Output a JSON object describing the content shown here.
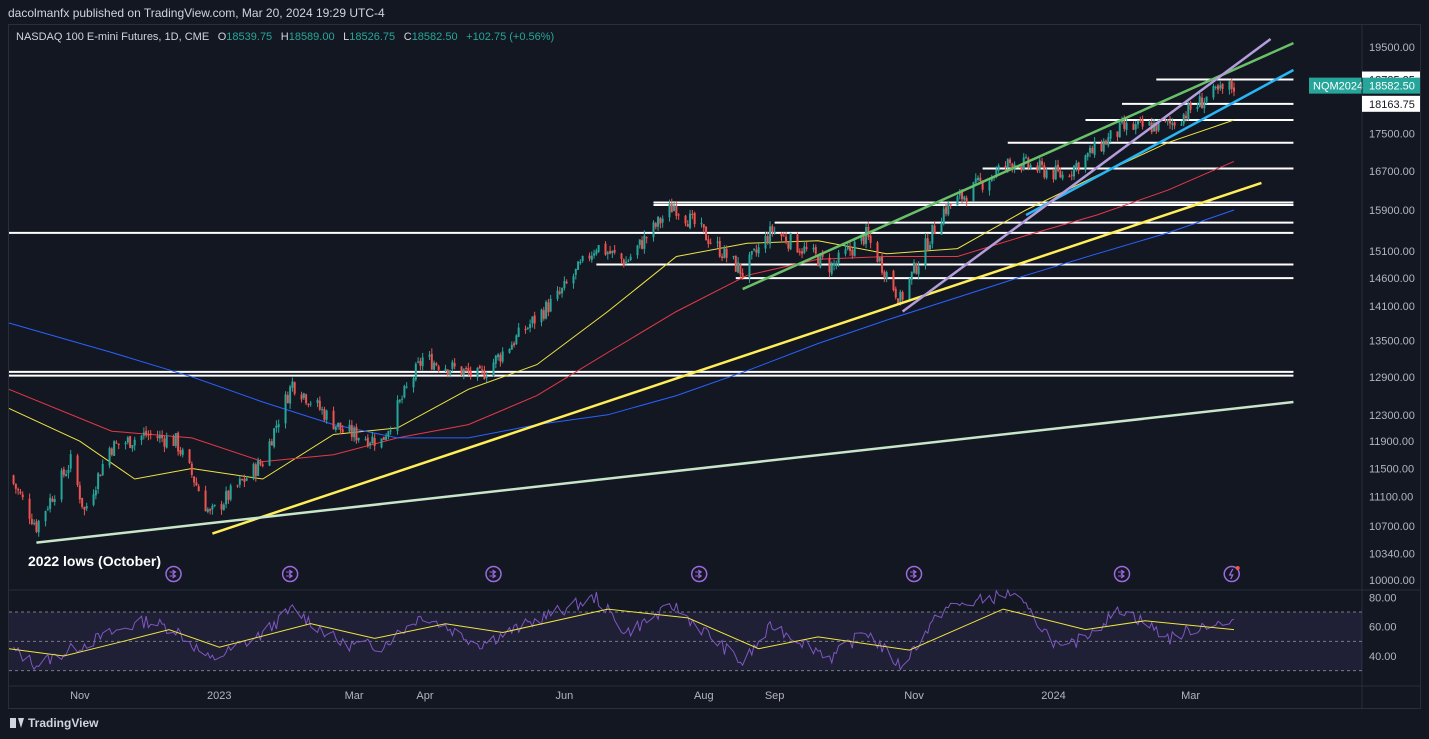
{
  "header": {
    "publisher": "dacolmanfx published on TradingView.com, Mar 20, 2024 19:29 UTC-4",
    "symbol_title": "NASDAQ 100 E-mini Futures, 1D, CME",
    "ohlc": {
      "O": "18539.75",
      "H": "18589.00",
      "L": "18526.75",
      "C": "18582.50",
      "change": "+102.75 (+0.56%)"
    }
  },
  "footer": {
    "brand": "TradingView"
  },
  "colors": {
    "background": "#131722",
    "grid": "#1e222d",
    "up": "#26a69a",
    "down": "#ef5350",
    "ma20": "#f0e442",
    "ma50": "#e63946",
    "ma200": "#2962ff",
    "rsi": "#7e57c2",
    "rsi_ma": "#f0e442",
    "trend_yellow": "#ffee58",
    "trend_green": "#6abf69",
    "trend_cyan": "#29b6f6",
    "trend_lavender": "#b39ddb",
    "trend_mint": "#c8e6c9",
    "horizontal": "#ffffff",
    "price_badge": "#26a69a"
  },
  "chart_data": [
    {
      "type": "candlestick",
      "title": "NASDAQ 100 E-mini Futures, 1D, CME",
      "price_axis_ticks": [
        19500,
        18725.25,
        18582.5,
        18163.75,
        17500,
        16700,
        15900,
        15100,
        14600,
        14100,
        13500,
        12900,
        12300,
        11900,
        11500,
        11100,
        10700,
        10340,
        10000
      ],
      "price_axis_labels": [
        "19500.00",
        "18725.25",
        "18582.50",
        "18163.75",
        "17500.00",
        "16700.00",
        "15900.00",
        "15100.00",
        "14600.00",
        "14100.00",
        "13500.00",
        "12900.00",
        "12300.00",
        "11900.00",
        "11500.00",
        "11100.00",
        "10700.00",
        "10340.00",
        "10000.00"
      ],
      "time_axis_labels": [
        "Nov",
        "2023",
        "Mar",
        "Apr",
        "Jun",
        "Aug",
        "Sep",
        "Nov",
        "2024",
        "Mar"
      ],
      "time_axis_dates": [
        "2022-11-01",
        "2023-01-01",
        "2023-03-01",
        "2023-04-01",
        "2023-06-01",
        "2023-08-01",
        "2023-09-01",
        "2023-11-01",
        "2024-01-01",
        "2024-03-01"
      ],
      "ylim": [
        10000,
        19800
      ],
      "xlim": [
        "2022-10-01",
        "2024-05-15"
      ],
      "close_path": [
        {
          "date": "2022-10-01",
          "close": 11400
        },
        {
          "date": "2022-10-13",
          "close": 10700
        },
        {
          "date": "2022-10-28",
          "close": 11600
        },
        {
          "date": "2022-11-03",
          "close": 10900
        },
        {
          "date": "2022-11-14",
          "close": 11800
        },
        {
          "date": "2022-11-30",
          "close": 12000
        },
        {
          "date": "2022-12-13",
          "close": 11900
        },
        {
          "date": "2022-12-28",
          "close": 10850
        },
        {
          "date": "2023-01-20",
          "close": 11600
        },
        {
          "date": "2023-02-02",
          "close": 12800
        },
        {
          "date": "2023-02-24",
          "close": 12050
        },
        {
          "date": "2023-03-13",
          "close": 11900
        },
        {
          "date": "2023-03-31",
          "close": 13200
        },
        {
          "date": "2023-04-25",
          "close": 12900
        },
        {
          "date": "2023-05-30",
          "close": 14300
        },
        {
          "date": "2023-06-15",
          "close": 15200
        },
        {
          "date": "2023-06-28",
          "close": 14900
        },
        {
          "date": "2023-07-19",
          "close": 16000
        },
        {
          "date": "2023-08-18",
          "close": 14700
        },
        {
          "date": "2023-08-31",
          "close": 15500
        },
        {
          "date": "2023-09-26",
          "close": 14800
        },
        {
          "date": "2023-10-11",
          "close": 15400
        },
        {
          "date": "2023-10-26",
          "close": 14200
        },
        {
          "date": "2023-11-14",
          "close": 15900
        },
        {
          "date": "2023-12-14",
          "close": 16900
        },
        {
          "date": "2024-01-05",
          "close": 16600
        },
        {
          "date": "2024-01-31",
          "close": 17600
        },
        {
          "date": "2024-02-21",
          "close": 17700
        },
        {
          "date": "2024-03-08",
          "close": 18300
        },
        {
          "date": "2024-03-20",
          "close": 18582.5
        }
      ],
      "moving_averages": [
        {
          "color": "#f0e442",
          "points": [
            {
              "date": "2022-10-01",
              "close": 12400
            },
            {
              "date": "2022-11-01",
              "close": 11900
            },
            {
              "date": "2022-11-25",
              "close": 11350
            },
            {
              "date": "2022-12-20",
              "close": 11500
            },
            {
              "date": "2023-01-20",
              "close": 11350
            },
            {
              "date": "2023-02-20",
              "close": 12000
            },
            {
              "date": "2023-03-20",
              "close": 12100
            },
            {
              "date": "2023-04-20",
              "close": 12700
            },
            {
              "date": "2023-05-20",
              "close": 13100
            },
            {
              "date": "2023-06-20",
              "close": 14000
            },
            {
              "date": "2023-07-20",
              "close": 15000
            },
            {
              "date": "2023-08-20",
              "close": 15250
            },
            {
              "date": "2023-09-20",
              "close": 15300
            },
            {
              "date": "2023-10-20",
              "close": 15050
            },
            {
              "date": "2023-11-20",
              "close": 15150
            },
            {
              "date": "2023-12-20",
              "close": 15900
            },
            {
              "date": "2024-01-20",
              "close": 16600
            },
            {
              "date": "2024-02-20",
              "close": 17300
            },
            {
              "date": "2024-03-20",
              "close": 17800
            }
          ]
        },
        {
          "color": "#e63946",
          "points": [
            {
              "date": "2022-10-01",
              "close": 12700
            },
            {
              "date": "2022-11-15",
              "close": 12050
            },
            {
              "date": "2022-12-20",
              "close": 11950
            },
            {
              "date": "2023-01-20",
              "close": 11600
            },
            {
              "date": "2023-02-20",
              "close": 11700
            },
            {
              "date": "2023-03-20",
              "close": 11950
            },
            {
              "date": "2023-04-20",
              "close": 12150
            },
            {
              "date": "2023-05-20",
              "close": 12600
            },
            {
              "date": "2023-06-20",
              "close": 13300
            },
            {
              "date": "2023-07-20",
              "close": 14000
            },
            {
              "date": "2023-08-20",
              "close": 14650
            },
            {
              "date": "2023-09-20",
              "close": 14950
            },
            {
              "date": "2023-10-20",
              "close": 15000
            },
            {
              "date": "2023-11-20",
              "close": 15000
            },
            {
              "date": "2023-12-20",
              "close": 15400
            },
            {
              "date": "2024-01-20",
              "close": 15800
            },
            {
              "date": "2024-02-20",
              "close": 16300
            },
            {
              "date": "2024-03-20",
              "close": 16900
            }
          ]
        },
        {
          "color": "#2962ff",
          "points": [
            {
              "date": "2022-10-01",
              "close": 13800
            },
            {
              "date": "2022-11-15",
              "close": 13300
            },
            {
              "date": "2022-12-20",
              "close": 12900
            },
            {
              "date": "2023-01-20",
              "close": 12500
            },
            {
              "date": "2023-02-20",
              "close": 12150
            },
            {
              "date": "2023-03-20",
              "close": 11950
            },
            {
              "date": "2023-04-20",
              "close": 11950
            },
            {
              "date": "2023-05-20",
              "close": 12150
            },
            {
              "date": "2023-06-20",
              "close": 12300
            },
            {
              "date": "2023-07-20",
              "close": 12600
            },
            {
              "date": "2023-08-20",
              "close": 13000
            },
            {
              "date": "2023-09-20",
              "close": 13450
            },
            {
              "date": "2023-10-20",
              "close": 13850
            },
            {
              "date": "2023-11-20",
              "close": 14250
            },
            {
              "date": "2023-12-20",
              "close": 14650
            },
            {
              "date": "2024-01-20",
              "close": 15050
            },
            {
              "date": "2024-02-20",
              "close": 15450
            },
            {
              "date": "2024-03-20",
              "close": 15900
            }
          ]
        }
      ],
      "horizontal_levels": [
        {
          "price": 18725.25,
          "from": "2024-02-15",
          "to": "2024-04-15"
        },
        {
          "price": 18163.75,
          "from": "2024-01-31",
          "to": "2024-04-15"
        },
        {
          "price": 17800,
          "from": "2024-01-15",
          "to": "2024-04-15"
        },
        {
          "price": 17300,
          "from": "2023-12-12",
          "to": "2024-04-15"
        },
        {
          "price": 16750,
          "from": "2023-12-01",
          "to": "2024-04-15"
        },
        {
          "price": 16050,
          "from": "2023-07-10",
          "to": "2024-04-15"
        },
        {
          "price": 16000,
          "from": "2023-07-10",
          "to": "2024-04-15"
        },
        {
          "price": 15650,
          "from": "2023-09-01",
          "to": "2024-04-15"
        },
        {
          "price": 15450,
          "from": "2022-10-01",
          "to": "2024-04-15"
        },
        {
          "price": 14850,
          "from": "2023-06-15",
          "to": "2024-04-15"
        },
        {
          "price": 14600,
          "from": "2023-08-15",
          "to": "2024-04-15"
        },
        {
          "price": 12980,
          "from": "2022-10-01",
          "to": "2024-04-15"
        },
        {
          "price": 12920,
          "from": "2022-10-01",
          "to": "2024-04-15"
        }
      ],
      "trendlines": [
        {
          "color": "#ffee58",
          "from": {
            "date": "2022-12-29",
            "price": 10600
          },
          "to": {
            "date": "2024-04-01",
            "price": 16450
          }
        },
        {
          "color": "#c8e6c9",
          "from": {
            "date": "2022-10-13",
            "price": 10480
          },
          "to": {
            "date": "2024-04-15",
            "price": 12500
          }
        },
        {
          "color": "#6abf69",
          "from": {
            "date": "2023-08-18",
            "price": 14400
          },
          "to": {
            "date": "2024-04-15",
            "price": 19600
          }
        },
        {
          "color": "#29b6f6",
          "from": {
            "date": "2023-12-20",
            "price": 15800
          },
          "to": {
            "date": "2024-04-15",
            "price": 18950
          }
        },
        {
          "color": "#b39ddb",
          "from": {
            "date": "2023-10-27",
            "price": 14000
          },
          "to": {
            "date": "2024-04-05",
            "price": 19700
          }
        }
      ],
      "annotations": [
        {
          "text": "2022 lows (October)",
          "date": "2022-10-13",
          "price": 10400
        }
      ],
      "event_marker_dates": [
        "2022-12-12",
        "2023-02-01",
        "2023-05-01",
        "2023-07-30",
        "2023-11-01",
        "2024-01-31",
        "2024-03-19"
      ],
      "last_price_tag": {
        "symbol": "NQM2024",
        "value": "18582.50"
      }
    },
    {
      "type": "line",
      "title": "RSI",
      "ylim": [
        25,
        85
      ],
      "axis_labels": [
        "80.00",
        "60.00",
        "40.00"
      ],
      "axis_values": [
        80,
        60,
        40
      ],
      "band": [
        30,
        70
      ],
      "series": [
        {
          "points": [
            {
              "date": "2022-10-01",
              "value": 46
            },
            {
              "date": "2022-10-13",
              "value": 34
            },
            {
              "date": "2022-11-01",
              "value": 47
            },
            {
              "date": "2022-11-14",
              "value": 55
            },
            {
              "date": "2022-11-30",
              "value": 64
            },
            {
              "date": "2022-12-13",
              "value": 58
            },
            {
              "date": "2022-12-28",
              "value": 37
            },
            {
              "date": "2023-01-20",
              "value": 55
            },
            {
              "date": "2023-02-02",
              "value": 72
            },
            {
              "date": "2023-02-24",
              "value": 48
            },
            {
              "date": "2023-03-13",
              "value": 47
            },
            {
              "date": "2023-03-31",
              "value": 68
            },
            {
              "date": "2023-04-25",
              "value": 48
            },
            {
              "date": "2023-05-30",
              "value": 71
            },
            {
              "date": "2023-06-15",
              "value": 80
            },
            {
              "date": "2023-06-28",
              "value": 56
            },
            {
              "date": "2023-07-19",
              "value": 74
            },
            {
              "date": "2023-08-18",
              "value": 35
            },
            {
              "date": "2023-08-31",
              "value": 61
            },
            {
              "date": "2023-09-26",
              "value": 39
            },
            {
              "date": "2023-10-11",
              "value": 57
            },
            {
              "date": "2023-10-26",
              "value": 33
            },
            {
              "date": "2023-11-14",
              "value": 72
            },
            {
              "date": "2023-12-14",
              "value": 83
            },
            {
              "date": "2024-01-05",
              "value": 43
            },
            {
              "date": "2024-01-31",
              "value": 72
            },
            {
              "date": "2024-02-21",
              "value": 52
            },
            {
              "date": "2024-03-08",
              "value": 62
            },
            {
              "date": "2024-03-20",
              "value": 61
            }
          ]
        },
        {
          "points": [
            {
              "date": "2022-10-01",
              "value": 45
            },
            {
              "date": "2022-10-25",
              "value": 40
            },
            {
              "date": "2022-11-20",
              "value": 50
            },
            {
              "date": "2022-12-10",
              "value": 58
            },
            {
              "date": "2023-01-01",
              "value": 46
            },
            {
              "date": "2023-02-10",
              "value": 62
            },
            {
              "date": "2023-03-10",
              "value": 52
            },
            {
              "date": "2023-04-10",
              "value": 62
            },
            {
              "date": "2023-05-05",
              "value": 56
            },
            {
              "date": "2023-06-20",
              "value": 72
            },
            {
              "date": "2023-07-25",
              "value": 66
            },
            {
              "date": "2023-08-25",
              "value": 45
            },
            {
              "date": "2023-09-20",
              "value": 53
            },
            {
              "date": "2023-10-30",
              "value": 44
            },
            {
              "date": "2023-12-10",
              "value": 72
            },
            {
              "date": "2024-01-15",
              "value": 58
            },
            {
              "date": "2024-02-10",
              "value": 64
            },
            {
              "date": "2024-03-20",
              "value": 58
            }
          ]
        }
      ]
    }
  ]
}
